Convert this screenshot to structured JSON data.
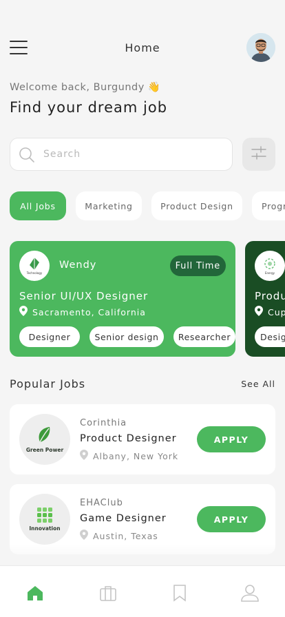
{
  "header": {
    "title": "Home"
  },
  "welcome": "Welcome back, Burgundy 👋",
  "headline": "Find your dream job",
  "search": {
    "placeholder": "Search",
    "value": ""
  },
  "categories": [
    "All Jobs",
    "Marketing",
    "Product Design",
    "Progr"
  ],
  "featured": [
    {
      "logo_text": "Technology",
      "company": "Wendy",
      "type": "Full Time",
      "title": "Senior UI/UX Designer",
      "location": "Sacramento, California",
      "tags": [
        "Designer",
        "Senior design",
        "Researcher"
      ]
    },
    {
      "logo_text": "Energy",
      "title": "Produ",
      "location": "Cup",
      "tags": [
        "Desig"
      ]
    }
  ],
  "popular": {
    "title": "Popular Jobs",
    "see_all": "See All",
    "items": [
      {
        "logo_brand": "Green Power",
        "company": "Corinthia",
        "title": "Product Designer",
        "location": "Albany, New York",
        "apply": "APPLY"
      },
      {
        "logo_brand": "Innovation",
        "company": "EHAClub",
        "title": "Game Designer",
        "location": "Austin, Texas",
        "apply": "APPLY"
      }
    ]
  },
  "nav": [
    "home-icon",
    "briefcase-icon",
    "bookmark-icon",
    "profile-icon"
  ],
  "colors": {
    "accent": "#4cb85e",
    "accent_dark": "#22663a",
    "card_dark": "#1a4d24",
    "background": "#f5f5f5"
  }
}
